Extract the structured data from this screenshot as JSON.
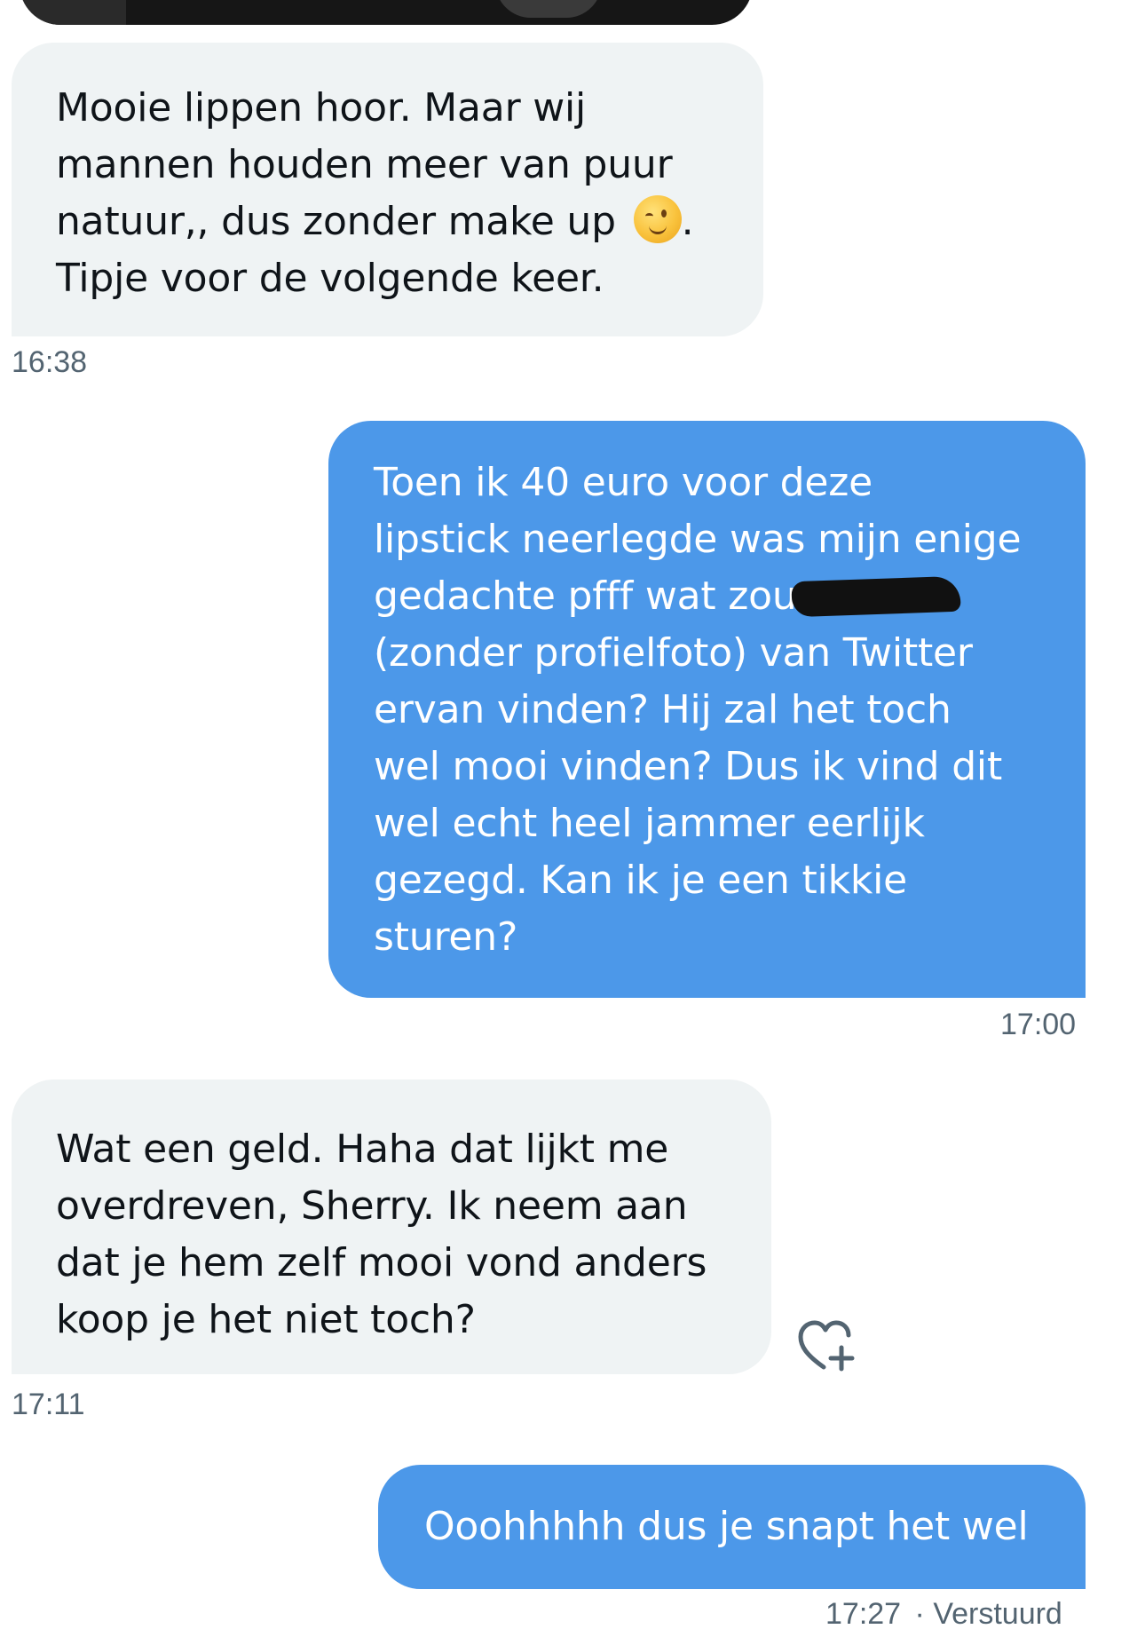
{
  "messages": [
    {
      "direction": "incoming",
      "lines": [
        "Mooie lippen hoor. Maar wij",
        "mannen houden meer van puur",
        "natuur,, dus zonder make up",
        "Tipje voor de volgende keer."
      ],
      "emoji": "winking-face",
      "emoji_suffix": ".",
      "time": "16:38"
    },
    {
      "direction": "outgoing",
      "lines": [
        "Toen ik 40 euro voor deze",
        "lipstick neerlegde was mijn enige",
        "gedachte pfff wat zou",
        "(zonder profielfoto) van Twitter",
        "ervan vinden? Hij zal het toch",
        "wel mooi vinden? Dus ik vind dit",
        "wel echt heel jammer eerlijk",
        "gezegd. Kan ik je een tikkie",
        "sturen?"
      ],
      "time": "17:00"
    },
    {
      "direction": "incoming",
      "lines": [
        "Wat een geld. Haha dat lijkt me",
        "overdreven, Sherry. Ik neem aan",
        "dat je hem zelf mooi vond anders",
        "koop je het niet toch?"
      ],
      "time": "17:11"
    },
    {
      "direction": "outgoing",
      "lines": [
        "Ooohhhhh dus je snapt het wel"
      ],
      "time": "17:27",
      "status": "· Verstuurd"
    }
  ],
  "icons": {
    "react": "heart-plus-icon"
  },
  "colors": {
    "incoming_bg": "#eff3f4",
    "outgoing_bg": "#4c98e9",
    "meta_text": "#536471"
  }
}
